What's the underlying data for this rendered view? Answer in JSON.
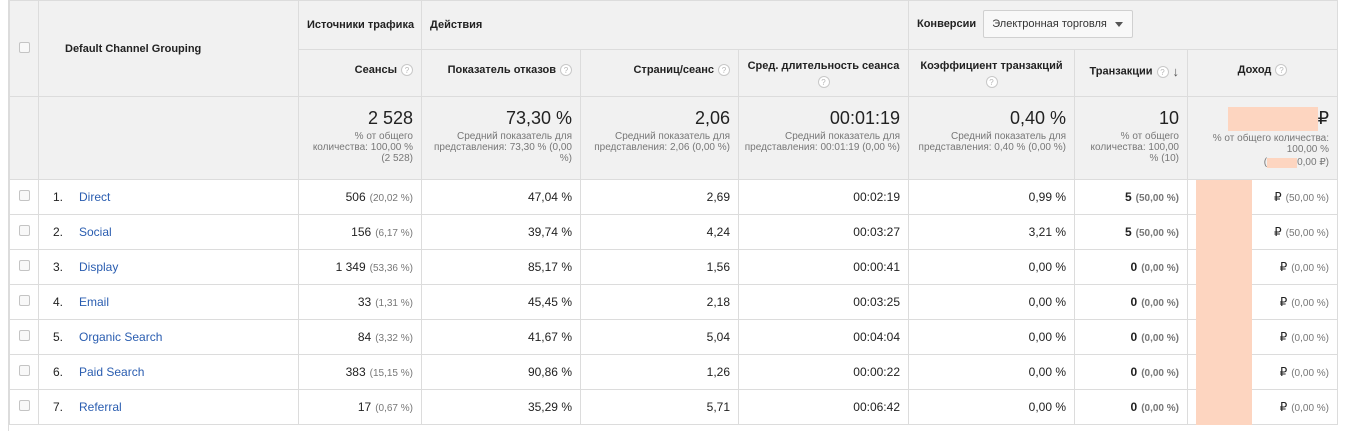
{
  "header": {
    "dimension": "Default Channel Grouping",
    "groups": {
      "traffic": "Источники трафика",
      "actions": "Действия",
      "conversions": "Конверсии",
      "conversion_select": "Электронная торговля"
    },
    "columns": {
      "sessions": "Сеансы",
      "bounce": "Показатель отказов",
      "pages": "Страниц/сеанс",
      "duration": "Сред. длительность сеанса",
      "conv_rate": "Коэффициент транзакций",
      "transactions": "Транзакции",
      "revenue": "Доход"
    },
    "help": "?"
  },
  "summary": {
    "sessions": {
      "big": "2 528",
      "sub": "% от общего количества: 100,00 % (2 528)"
    },
    "bounce": {
      "big": "73,30 %",
      "sub": "Средний показатель для представления: 73,30 % (0,00 %)"
    },
    "pages": {
      "big": "2,06",
      "sub": "Средний показатель для представления: 2,06 (0,00 %)"
    },
    "duration": {
      "big": "00:01:19",
      "sub": "Средний показатель для представления: 00:01:19 (0,00 %)"
    },
    "conv_rate": {
      "big": "0,40 %",
      "sub": "Средний показатель для представления: 0,40 % (0,00 %)"
    },
    "transactions": {
      "big": "10",
      "sub": "% от общего количества: 100,00 % (10)"
    },
    "revenue": {
      "big": "₽",
      "sub": "% от общего количества: 100,00 %",
      "sub2": "(",
      "sub3": "0,00 ₽)"
    }
  },
  "rows": [
    {
      "idx": "1.",
      "name": "Direct",
      "sessions": "506",
      "sessions_pct": "(20,02 %)",
      "bounce": "47,04 %",
      "pages": "2,69",
      "duration": "00:02:19",
      "conv_rate": "0,99 %",
      "trans": "5",
      "trans_pct": "(50,00 %)",
      "rub": "₽",
      "rev_pct": "(50,00 %)"
    },
    {
      "idx": "2.",
      "name": "Social",
      "sessions": "156",
      "sessions_pct": "(6,17 %)",
      "bounce": "39,74 %",
      "pages": "4,24",
      "duration": "00:03:27",
      "conv_rate": "3,21 %",
      "trans": "5",
      "trans_pct": "(50,00 %)",
      "rub": "₽",
      "rev_pct": "(50,00 %)"
    },
    {
      "idx": "3.",
      "name": "Display",
      "sessions": "1 349",
      "sessions_pct": "(53,36 %)",
      "bounce": "85,17 %",
      "pages": "1,56",
      "duration": "00:00:41",
      "conv_rate": "0,00 %",
      "trans": "0",
      "trans_pct": "(0,00 %)",
      "rub": "₽",
      "rev_pct": "(0,00 %)"
    },
    {
      "idx": "4.",
      "name": "Email",
      "sessions": "33",
      "sessions_pct": "(1,31 %)",
      "bounce": "45,45 %",
      "pages": "2,18",
      "duration": "00:03:25",
      "conv_rate": "0,00 %",
      "trans": "0",
      "trans_pct": "(0,00 %)",
      "rub": "₽",
      "rev_pct": "(0,00 %)"
    },
    {
      "idx": "5.",
      "name": "Organic Search",
      "sessions": "84",
      "sessions_pct": "(3,32 %)",
      "bounce": "41,67 %",
      "pages": "5,04",
      "duration": "00:04:04",
      "conv_rate": "0,00 %",
      "trans": "0",
      "trans_pct": "(0,00 %)",
      "rub": "₽",
      "rev_pct": "(0,00 %)"
    },
    {
      "idx": "6.",
      "name": "Paid Search",
      "sessions": "383",
      "sessions_pct": "(15,15 %)",
      "bounce": "90,86 %",
      "pages": "1,26",
      "duration": "00:00:22",
      "conv_rate": "0,00 %",
      "trans": "0",
      "trans_pct": "(0,00 %)",
      "rub": "₽",
      "rev_pct": "(0,00 %)"
    },
    {
      "idx": "7.",
      "name": "Referral",
      "sessions": "17",
      "sessions_pct": "(0,67 %)",
      "bounce": "35,29 %",
      "pages": "5,71",
      "duration": "00:06:42",
      "conv_rate": "0,00 %",
      "trans": "0",
      "trans_pct": "(0,00 %)",
      "rub": "₽",
      "rev_pct": "(0,00 %)"
    }
  ],
  "colors": {
    "link": "#2a5db0",
    "header_bg": "#f1f1f1",
    "redaction": "#fdd5c0"
  }
}
